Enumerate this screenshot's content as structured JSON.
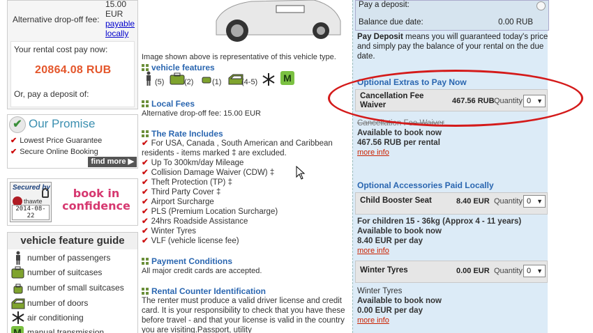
{
  "left": {
    "dropoff_label": "Alternative drop-off fee:",
    "dropoff_amount": "15.00 EUR",
    "dropoff_link": "payable locally",
    "pay_now_label": "Your rental cost pay now:",
    "pay_now_price": "20864.08 RUB",
    "deposit_label": "Or, pay a deposit of:",
    "promise": {
      "title": "Our Promise",
      "items": [
        "Lowest Price Guarantee",
        "Secure Online Booking"
      ],
      "find_more": "find more"
    },
    "seal": {
      "secured_by": "Secured by",
      "brand": "thawte",
      "date": "2014-08-22",
      "book_text": "book in confidence"
    },
    "guide": {
      "title": "vehicle feature guide",
      "items": [
        {
          "icon": "person-icon",
          "label": "number of passengers"
        },
        {
          "icon": "suitcase-icon",
          "label": "number of suitcases"
        },
        {
          "icon": "small-suitcase-icon",
          "label": "number of small suitcases"
        },
        {
          "icon": "car-door-icon",
          "label": "number of doors"
        },
        {
          "icon": "snowflake-icon",
          "label": "air conditioning"
        },
        {
          "icon": "manual-m-icon",
          "label": "manual transmission"
        }
      ]
    }
  },
  "middle": {
    "image_note": "Image shown above is representative of this vehicle type.",
    "features_title": "vehicle features",
    "features": {
      "passengers": "(5)",
      "suitcases": "(2)",
      "small_suitcases": "(1)",
      "doors": "(4-5)",
      "transmission": "M"
    },
    "local_fees_title": "Local Fees",
    "local_fees_text": "Alternative drop-off fee:  15.00 EUR",
    "rate_title": "The Rate Includes",
    "rate_items": [
      "For USA, Canada , South American and Caribbean residents - items marked ‡ are excluded.",
      "Up To 300km/day Mileage",
      "Collision Damage Waiver (CDW) ‡",
      "Theft Protection (TP) ‡",
      "Third Party Cover ‡",
      "Airport Surcharge",
      "PLS (Premium Location Surcharge)",
      "24hrs Roadside Assistance",
      "Winter Tyres",
      "VLF (vehicle license fee)"
    ],
    "payment_title": "Payment Conditions",
    "payment_text": "All major credit cards are accepted.",
    "rci_title": "Rental Counter Identification",
    "rci_text": "The renter must produce a valid driver license and credit card. It is your responsibility to check that you have these before travel - and that your license is valid in the country you are visiting.Passport, utility"
  },
  "right": {
    "pay_deposit_label": "Pay a deposit:",
    "balance_label": "Balance due date:",
    "balance_value": "0.00 RUB",
    "deposit_explain_bold": "Pay Deposit",
    "deposit_explain": " means you will guaranteed today's price and simply pay the balance of your rental on the due date.",
    "extras_title": "Optional Extras to Pay Now",
    "cancellation": {
      "name_line1": "Cancellation Fee",
      "name_line2": "Waiver",
      "price": "467.56 RUB",
      "quantity_label": "Quantity",
      "qty": "0",
      "info_title": "Cancellation Fee Waiver",
      "avail": "Available to book now",
      "rate": "467.56 RUB per rental",
      "more": "more info"
    },
    "accessories_title": "Optional Accessories Paid Locally",
    "booster": {
      "name": "Child Booster Seat",
      "price": "8.40 EUR",
      "quantity_label": "Quantity",
      "qty": "0",
      "desc": "For children 15 - 36kg (Approx 4 - 11 years)",
      "avail": "Available to book now",
      "rate": "8.40 EUR per day",
      "more": "more info"
    },
    "tyres": {
      "name": "Winter Tyres",
      "price": "0.00 EUR",
      "quantity_label": "Quantity",
      "qty": "0",
      "desc": "Winter Tyres",
      "avail": "Available to book now",
      "rate": "0.00 EUR per day",
      "more": "more info"
    }
  },
  "colors": {
    "accent_blue": "#2a66b0",
    "price_orange": "#e4562b",
    "panel_blue": "#dcebf7",
    "annotation_red": "#d41a1a"
  }
}
